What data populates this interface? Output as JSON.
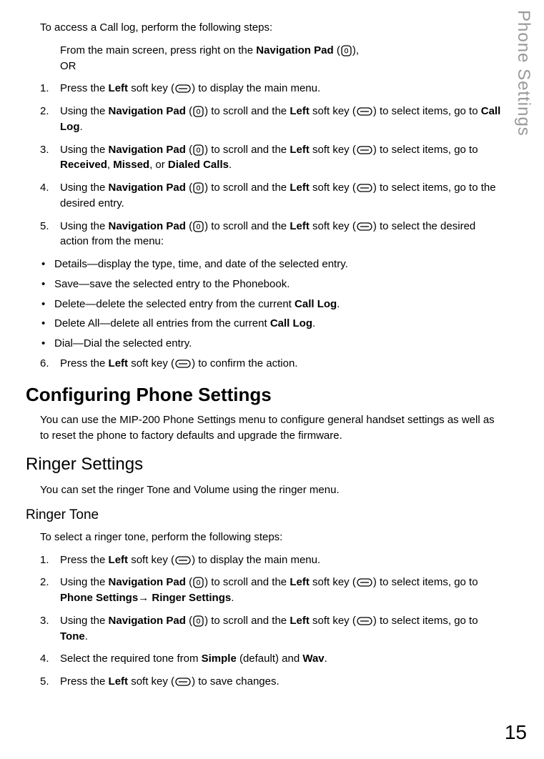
{
  "side_title": "Phone Settings",
  "page_number": "15",
  "intro": "To access a Call log, perform the following steps:",
  "intro_sub_line1_a": "From the main screen, press right on the ",
  "intro_sub_line1_b": "Navigation Pad",
  "intro_sub_line1_c": " (",
  "intro_sub_line1_d": "),",
  "intro_sub_line2": "OR",
  "step1_a": "Press the ",
  "step1_b": "Left",
  "step1_c": " soft key (",
  "step1_d": ") to display the main menu.",
  "step2_a": "Using the ",
  "step2_b": "Navigation Pad",
  "step2_c": " (",
  "step2_d": ") to scroll and the ",
  "step2_e": "Left",
  "step2_f": " soft key (",
  "step2_g": ") to select items, go to ",
  "step2_h": "Call Log",
  "step2_i": ".",
  "step3_a": "Using the ",
  "step3_b": "Navigation Pad",
  "step3_c": " (",
  "step3_d": ") to scroll and the ",
  "step3_e": "Left",
  "step3_f": " soft key (",
  "step3_g": ") to select items, go to ",
  "step3_h": "Received",
  "step3_i": ", ",
  "step3_j": "Missed",
  "step3_k": ", or ",
  "step3_l": "Dialed Calls",
  "step3_m": ".",
  "step4_a": "Using the ",
  "step4_b": "Navigation Pad",
  "step4_c": " (",
  "step4_d": ") to scroll and the ",
  "step4_e": "Left",
  "step4_f": " soft key (",
  "step4_g": ") to select items, go to the desired entry.",
  "step5_a": "Using the ",
  "step5_b": "Navigation Pad",
  "step5_c": " (",
  "step5_d": ") to scroll and the ",
  "step5_e": "Left",
  "step5_f": " soft key (",
  "step5_g": ") to select the desired action from the menu:",
  "bullet1": "Details—display the type, time, and date of the selected entry.",
  "bullet2": "Save—save the selected entry to the Phonebook.",
  "bullet3_a": "Delete—delete the selected entry from the current ",
  "bullet3_b": "Call Log",
  "bullet3_c": ".",
  "bullet4_a": "Delete All—delete all entries from the current ",
  "bullet4_b": "Call Log",
  "bullet4_c": ".",
  "bullet5": "Dial—Dial the selected entry.",
  "step6_a": "Press the ",
  "step6_b": "Left",
  "step6_c": " soft key (",
  "step6_d": ") to confirm the action.",
  "h1": "Configuring Phone Settings",
  "h1_para": "You can use the MIP-200 Phone Settings menu to configure general handset settings as well as to reset the phone to factory defaults and upgrade the firmware.",
  "h2": "Ringer Settings",
  "h2_para": "You can set the ringer Tone and Volume using the ringer menu.",
  "h3": "Ringer Tone",
  "h3_intro": "To select a ringer tone, perform the following steps:",
  "rstep1_a": "Press the ",
  "rstep1_b": "Left",
  "rstep1_c": " soft key (",
  "rstep1_d": ") to display the main menu.",
  "rstep2_a": "Using the ",
  "rstep2_b": "Navigation Pad",
  "rstep2_c": " (",
  "rstep2_d": ") to scroll and the ",
  "rstep2_e": "Left",
  "rstep2_f": " soft key (",
  "rstep2_g": ") to select items, go to ",
  "rstep2_h": "Phone Settings",
  "rstep2_arrow": "→ ",
  "rstep2_i": "Ringer Settings",
  "rstep2_j": ".",
  "rstep3_a": "Using the ",
  "rstep3_b": "Navigation Pad",
  "rstep3_c": " (",
  "rstep3_d": ") to scroll and the ",
  "rstep3_e": "Left",
  "rstep3_f": " soft key (",
  "rstep3_g": ") to select items, go to ",
  "rstep3_h": "Tone",
  "rstep3_i": ".",
  "rstep4_a": "Select the required tone from ",
  "rstep4_b": "Simple",
  "rstep4_c": " (default) and ",
  "rstep4_d": "Wav",
  "rstep4_e": ".",
  "rstep5_a": "Press the ",
  "rstep5_b": "Left",
  "rstep5_c": " soft key (",
  "rstep5_d": ") to save changes.",
  "nums": {
    "n1": "1.",
    "n2": "2.",
    "n3": "3.",
    "n4": "4.",
    "n5": "5.",
    "n6": "6."
  }
}
